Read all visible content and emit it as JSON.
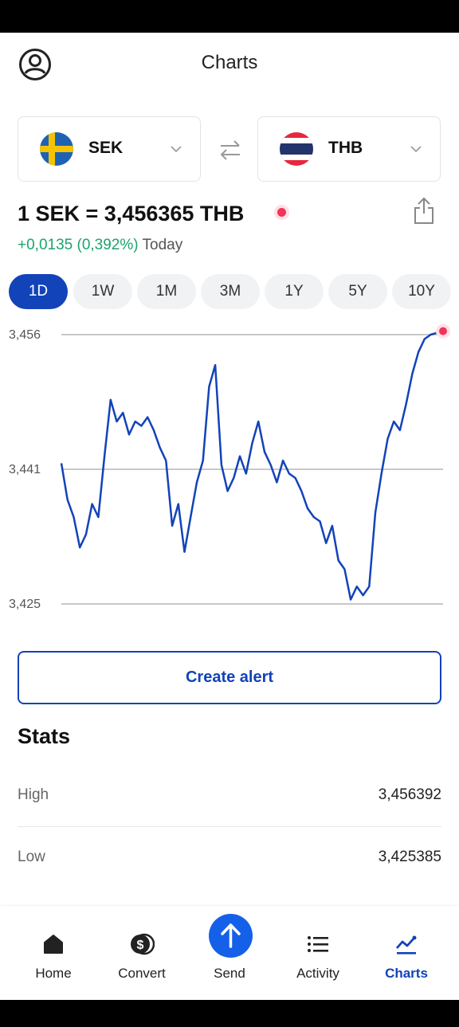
{
  "header": {
    "title": "Charts"
  },
  "pair": {
    "from": {
      "code": "SEK"
    },
    "to": {
      "code": "THB"
    }
  },
  "rate": {
    "text": "1 SEK = 3,456365 THB",
    "change": "+0,0135 (0,392%)",
    "period": "Today"
  },
  "ranges": [
    "1D",
    "1W",
    "1M",
    "3M",
    "1Y",
    "5Y",
    "10Y"
  ],
  "active_range": "1D",
  "chart_data": {
    "type": "line",
    "y_ticks": [
      "3,456",
      "3,441",
      "3,425"
    ],
    "ylim": [
      3.425,
      3.456
    ],
    "grid": true,
    "series": [
      {
        "color": "#1243b8",
        "values": [
          3.4412,
          3.437,
          3.435,
          3.4315,
          3.433,
          3.4365,
          3.435,
          3.442,
          3.4485,
          3.446,
          3.447,
          3.4445,
          3.446,
          3.4455,
          3.4465,
          3.445,
          3.443,
          3.4415,
          3.434,
          3.4365,
          3.431,
          3.435,
          3.439,
          3.4415,
          3.45,
          3.4525,
          3.441,
          3.438,
          3.4395,
          3.442,
          3.44,
          3.4435,
          3.446,
          3.4425,
          3.441,
          3.439,
          3.4415,
          3.44,
          3.4395,
          3.438,
          3.436,
          3.435,
          3.4345,
          3.432,
          3.434,
          3.43,
          3.429,
          3.4255,
          3.427,
          3.426,
          3.427,
          3.4355,
          3.44,
          3.444,
          3.446,
          3.445,
          3.448,
          3.4515,
          3.454,
          3.4555,
          3.456,
          3.4562,
          3.4564
        ]
      }
    ],
    "current_point_color": "#f0345a"
  },
  "alert": {
    "label": "Create alert"
  },
  "stats": {
    "title": "Stats",
    "rows": [
      {
        "label": "High",
        "value": "3,456392"
      },
      {
        "label": "Low",
        "value": "3,425385"
      }
    ]
  },
  "tabs": [
    {
      "label": "Home",
      "icon": "home-icon"
    },
    {
      "label": "Convert",
      "icon": "dollar-coin-icon"
    },
    {
      "label": "Send",
      "icon": "arrow-up-icon"
    },
    {
      "label": "Activity",
      "icon": "list-icon"
    },
    {
      "label": "Charts",
      "icon": "chart-line-icon"
    }
  ],
  "active_tab": "Charts",
  "colors": {
    "accent": "#1243b8",
    "positive": "#1aa56b",
    "live": "#f0345a",
    "send": "#1560e8"
  }
}
